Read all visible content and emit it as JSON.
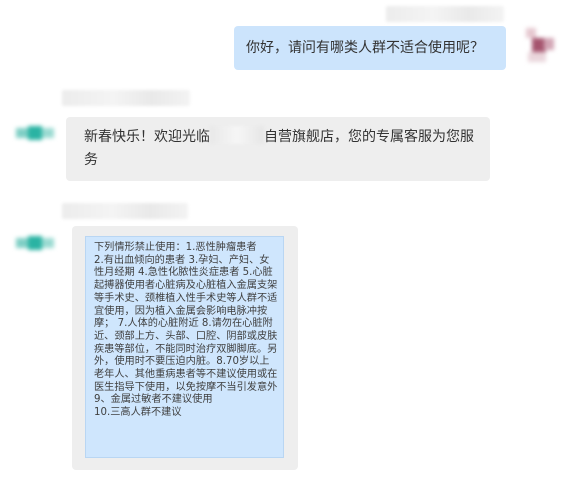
{
  "chat": {
    "messages": [
      {
        "sender": "customer",
        "text": "你好，请问有哪类人群不适合使用呢？"
      },
      {
        "sender": "service",
        "text_before": "新春快乐！欢迎光临",
        "text_after": "自营旗舰店，您的专属客服为您服务"
      },
      {
        "sender": "service",
        "text": "下列情形禁止使用：1.恶性肿瘤患者\n2.有出血倾向的患者 3.孕妇、产妇、女性月经期 4.急性化脓性炎症患者 5.心脏起搏器使用者心脏病及心脏植入金属支架等手术史、颈椎植入性手术史等人群不适宜使用，因为植入金属会影响电脉冲按摩； 7.人体的心脏附近 8.请勿在心脏附近、颈部上方、头部、口腔、阴部或皮肤疾患等部位，不能同时治疗双脚脚底。另外，使用时不要压迫内脏。8.70岁以上老年人、其他重病患者等不建议使用或在医生指导下使用，以免按摩不当引发意外\n9、金属过敏者不建议使用\n10.三高人群不建议"
      }
    ]
  }
}
